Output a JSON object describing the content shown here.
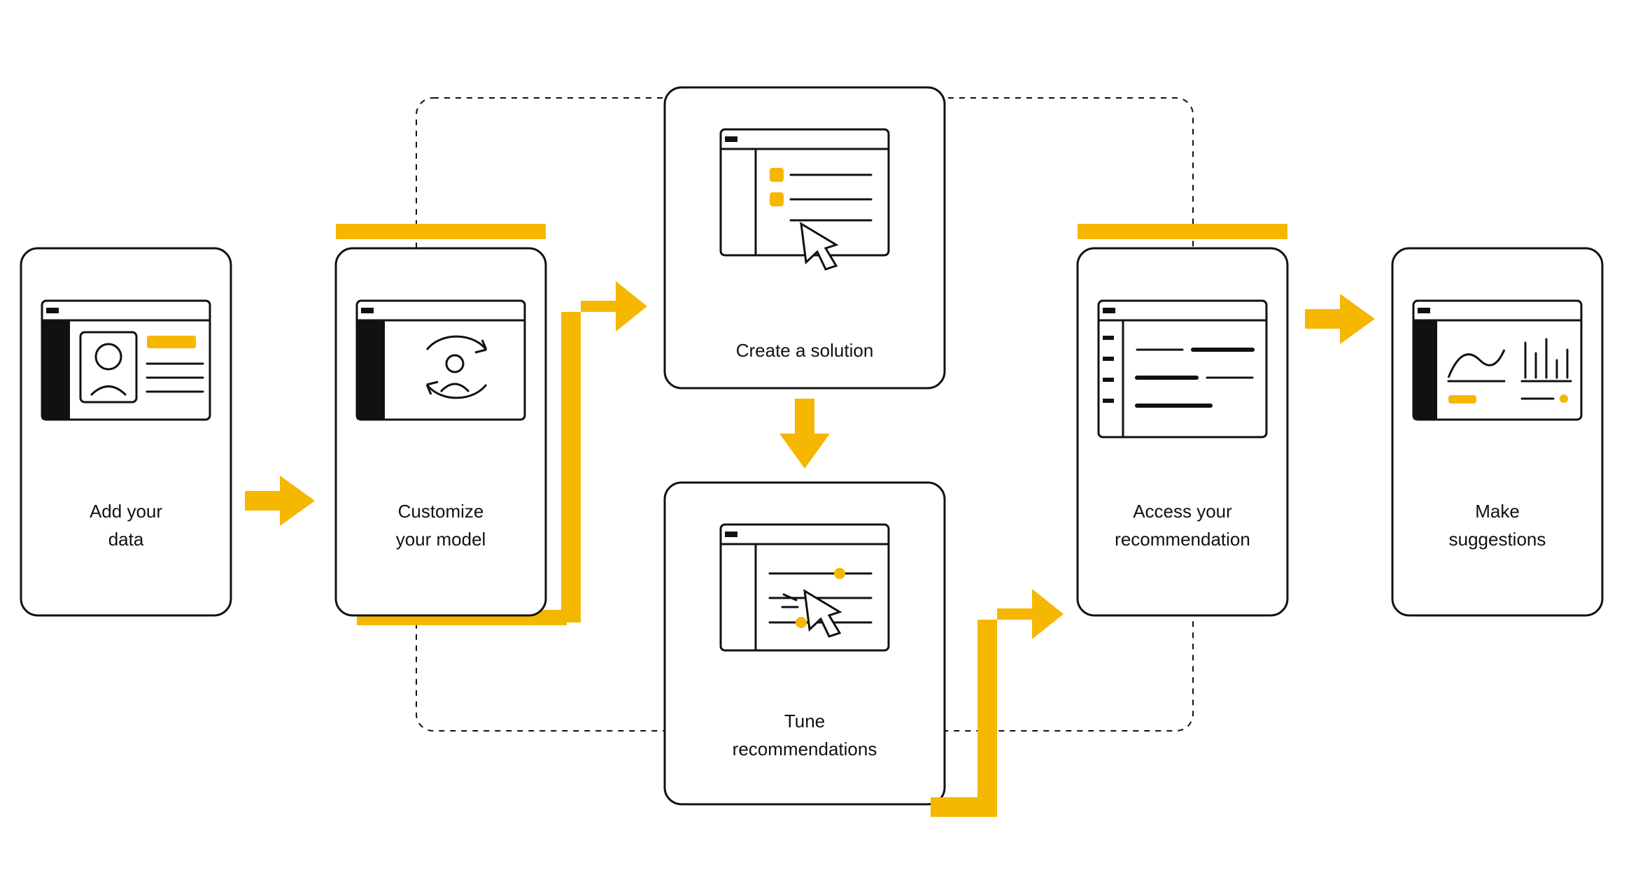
{
  "accent_color": "#f5b700",
  "steps": [
    {
      "id": "add-data",
      "label_line1": "Add your",
      "label_line2": "data"
    },
    {
      "id": "customize",
      "label_line1": "Customize",
      "label_line2": "your model"
    },
    {
      "id": "create",
      "label_line1": "Create a solution",
      "label_line2": ""
    },
    {
      "id": "tune",
      "label_line1": "Tune",
      "label_line2": "recommendations"
    },
    {
      "id": "access",
      "label_line1": "Access your",
      "label_line2": "recommendation"
    },
    {
      "id": "suggest",
      "label_line1": "Make",
      "label_line2": "suggestions"
    }
  ]
}
